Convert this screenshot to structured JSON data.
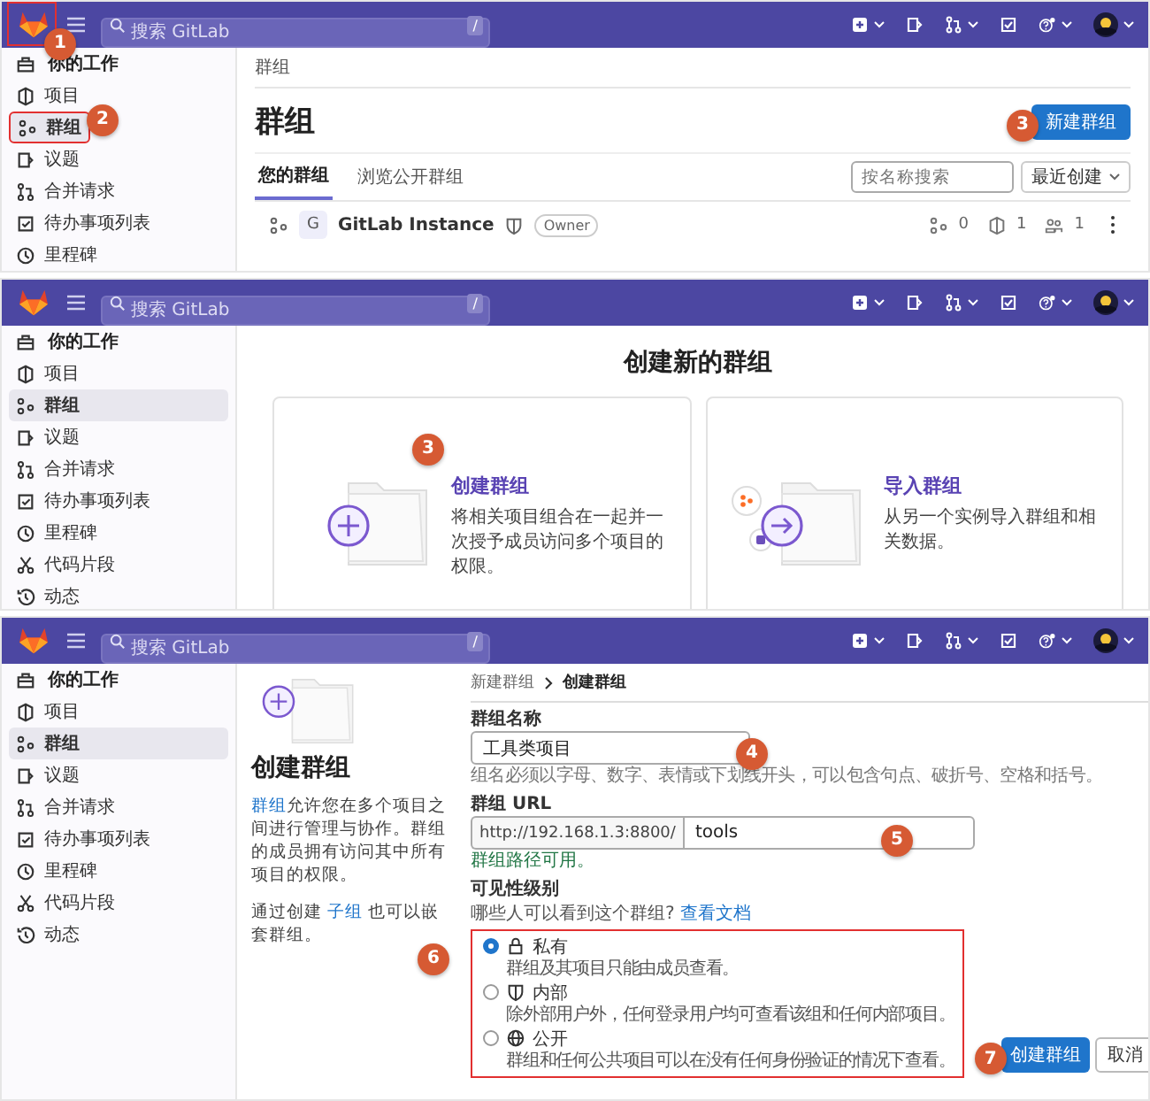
{
  "panels": [
    {
      "kind": "group_list",
      "top_bar": {
        "search": {
          "placeholder": "搜索 GitLab",
          "shortcut": "/"
        },
        "logo_highlighted": true,
        "logo_marker": "1"
      },
      "sidebar": {
        "title": "你的工作",
        "items": [
          {
            "label": "项目",
            "selected": false
          },
          {
            "label": "群组",
            "selected": true,
            "highlighted": true,
            "marker": "2"
          },
          {
            "label": "议题",
            "selected": false
          },
          {
            "label": "合并请求",
            "selected": false
          },
          {
            "label": "待办事项列表",
            "selected": false
          },
          {
            "label": "里程碑",
            "selected": false
          }
        ]
      },
      "breadcrumb": "群组",
      "title": "群组",
      "new_button": {
        "label": "新建群组",
        "marker": "3"
      },
      "tabs": [
        {
          "label": "您的群组",
          "selected": true
        },
        {
          "label": "浏览公开群组",
          "selected": false
        }
      ],
      "filter": {
        "placeholder": "按名称搜索",
        "sort": "最近创建"
      },
      "groups": [
        {
          "avatar": "G",
          "name": "GitLab Instance",
          "role": "Owner",
          "subgroups": "0",
          "projects": "1",
          "members": "1"
        }
      ]
    },
    {
      "kind": "new_group",
      "top_bar": {
        "search": {
          "placeholder": "搜索 GitLab",
          "shortcut": "/"
        }
      },
      "sidebar": {
        "title": "你的工作",
        "items": [
          {
            "label": "项目",
            "selected": false
          },
          {
            "label": "群组",
            "selected": true
          },
          {
            "label": "议题",
            "selected": false
          },
          {
            "label": "合并请求",
            "selected": false
          },
          {
            "label": "待办事项列表",
            "selected": false
          },
          {
            "label": "里程碑",
            "selected": false
          },
          {
            "label": "代码片段",
            "selected": false
          },
          {
            "label": "动态",
            "selected": false
          }
        ]
      },
      "title": "创建新的群组",
      "options": [
        {
          "title": "创建群组",
          "description": "将相关项目组合在一起并一次授予成员访问多个项目的权限。",
          "marker": "3"
        },
        {
          "title": "导入群组",
          "description": "从另一个实例导入群组和相关数据。"
        }
      ]
    },
    {
      "kind": "create_group",
      "top_bar": {
        "search": {
          "placeholder": "搜索 GitLab",
          "shortcut": "/"
        }
      },
      "sidebar": {
        "title": "你的工作",
        "items": [
          {
            "label": "项目",
            "selected": false
          },
          {
            "label": "群组",
            "selected": true
          },
          {
            "label": "议题",
            "selected": false
          },
          {
            "label": "合并请求",
            "selected": false
          },
          {
            "label": "待办事项列表",
            "selected": false
          },
          {
            "label": "里程碑",
            "selected": false
          },
          {
            "label": "代码片段",
            "selected": false
          },
          {
            "label": "动态",
            "selected": false
          }
        ]
      },
      "intro": {
        "title": "创建群组",
        "link": "群组",
        "text": "允许您在多个项目之间进行管理与协作。群组的成员拥有访问其中所有项目的权限。",
        "note_before": "通过创建 ",
        "note_link": "子组",
        "note_after": " 也可以嵌套群组。"
      },
      "breadcrumb": [
        {
          "label": "新建群组"
        },
        {
          "label": "创建群组"
        }
      ],
      "name_field": {
        "label": "群组名称",
        "value": "工具类项目",
        "marker": "4",
        "hint": "组名必须以字母、数字、表情或下划线开头，可以包含句点、破折号、空格和括号。"
      },
      "url_field": {
        "label": "群组 URL",
        "prefix": "http://192.168.1.3:8800/",
        "value": "tools",
        "marker": "5",
        "status": "群组路径可用。"
      },
      "visibility": {
        "label": "可见性级别",
        "question": "哪些人可以看到这个群组?",
        "docs_link": "查看文档",
        "marker": "6",
        "highlighted": true,
        "options": [
          {
            "label": "私有",
            "description": "群组及其项目只能由成员查看。",
            "selected": true
          },
          {
            "label": "内部",
            "description": "除外部用户外，任何登录用户均可查看该组和任何内部项目。",
            "selected": false
          },
          {
            "label": "公开",
            "description": "群组和任何公共项目可以在没有任何身份验证的情况下查看。",
            "selected": false
          }
        ]
      },
      "buttons": {
        "submit": "创建群组",
        "submit_marker": "7",
        "cancel": "取消"
      }
    }
  ]
}
